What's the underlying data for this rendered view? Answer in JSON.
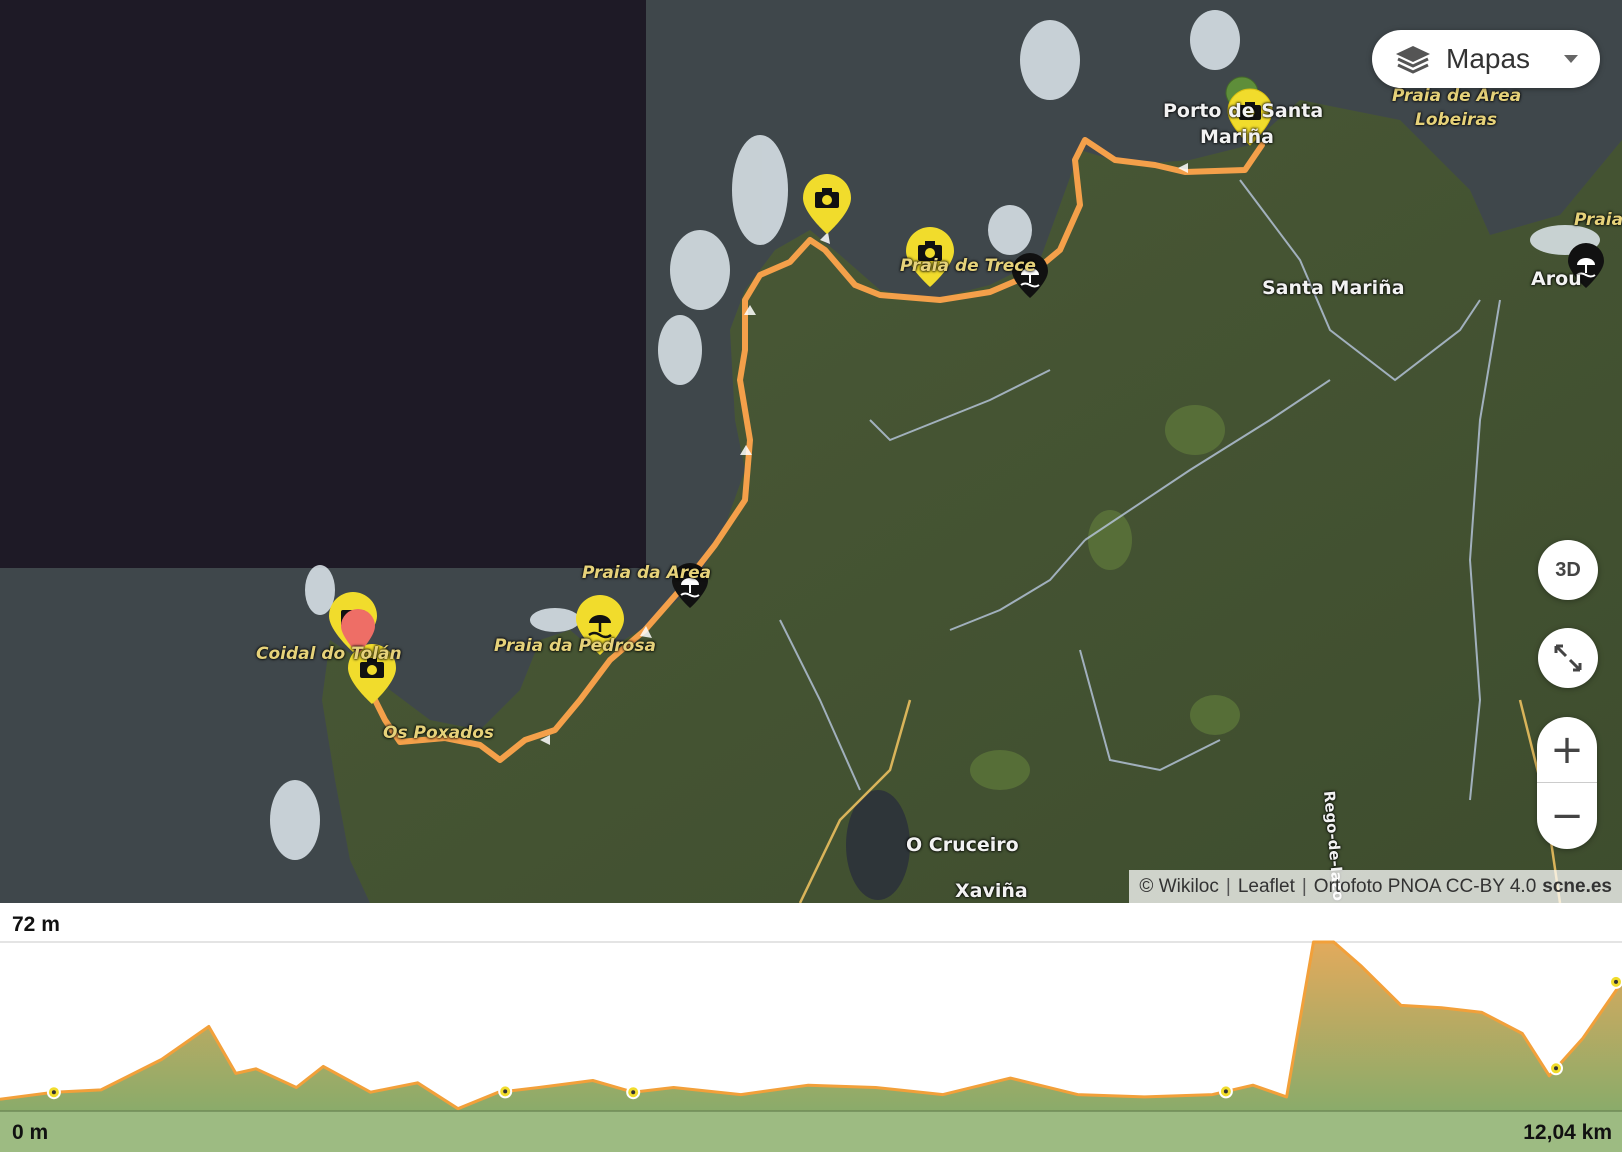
{
  "map": {
    "layer_button_label": "Mapas",
    "btn_3d_label": "3D",
    "zoom_in_label": "+",
    "zoom_out_label": "−",
    "attribution": {
      "wikiloc": "© Wikiloc",
      "leaflet": "Leaflet",
      "ortofoto": "Ortofoto PNOA CC-BY 4.0",
      "scne": "scne.es"
    },
    "labels": {
      "porto_santa": "Porto de Santa",
      "marina": "Mariña",
      "praia_area_lobeiras_1": "Praia de Area",
      "praia_area_lobeiras_2": "Lobeiras",
      "praia_right": "Praia",
      "santa_marina": "Santa Mariña",
      "arou": "Arou",
      "praia_trece": "Praia de Trece",
      "praia_area": "Praia da Area",
      "praia_pedrosa": "Praia da Pedrosa",
      "coidal": "Coidal do Tolán",
      "os_poxados": "Os Poxados",
      "o_cruceiro": "O Cruceiro",
      "xavina": "Xaviña",
      "rego": "Rego-de-lazo"
    },
    "icons": [
      "layers-icon",
      "fullscreen-icon",
      "start-marker-icon",
      "end-marker-icon",
      "photo-marker-icon",
      "beach-marker-icon"
    ],
    "colors": {
      "track": "#f4a04a",
      "photo_marker": "#f1dc2c",
      "beach_marker": "#111111",
      "start_marker": "#5e8e3a",
      "end_marker": "#ee6e66"
    }
  },
  "profile": {
    "max_label": "72 m",
    "min_label": "0 m",
    "distance_label": "12,04 km",
    "colors": {
      "line": "#f2a03a",
      "fill_top": "#e2aa5c",
      "fill_bottom": "#8aab6a"
    }
  },
  "chart_data": {
    "type": "area",
    "title": "",
    "xlabel": "",
    "ylabel": "",
    "x_unit": "km",
    "y_unit": "m",
    "xlim": [
      0,
      12.04
    ],
    "ylim": [
      0,
      72
    ],
    "x": [
      0,
      0.4,
      0.75,
      1.2,
      1.55,
      1.75,
      1.9,
      2.2,
      2.4,
      2.75,
      3.1,
      3.4,
      3.7,
      4.0,
      4.4,
      4.7,
      5.0,
      5.5,
      6.0,
      6.5,
      7.0,
      7.5,
      8.0,
      8.5,
      9.0,
      9.3,
      9.55,
      9.75,
      9.9,
      10.1,
      10.4,
      10.7,
      11.0,
      11.3,
      11.5,
      11.75,
      12.04
    ],
    "y": [
      5,
      8,
      9,
      22,
      36,
      16,
      18,
      10,
      19,
      8,
      12,
      1,
      8,
      10,
      13,
      8,
      10,
      7,
      11,
      10,
      7,
      14,
      7,
      6,
      7,
      11,
      6,
      72,
      72,
      62,
      45,
      44,
      42,
      33,
      15,
      31,
      55
    ],
    "waypoints_x": [
      0.4,
      3.75,
      4.7,
      9.1,
      11.55,
      12.04
    ]
  }
}
